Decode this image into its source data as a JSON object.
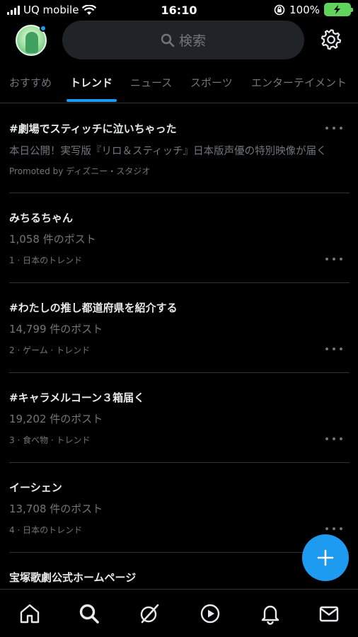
{
  "status_bar": {
    "carrier": "UQ mobile",
    "time": "16:10",
    "battery": "100%"
  },
  "header": {
    "search_placeholder": "検索"
  },
  "tabs": [
    {
      "label": "おすすめ"
    },
    {
      "label": "トレンド"
    },
    {
      "label": "ニュース"
    },
    {
      "label": "スポーツ"
    },
    {
      "label": "エンターテイメント"
    }
  ],
  "active_tab": "トレンド",
  "trends": [
    {
      "title": "#劇場でスティッチに泣いちゃった",
      "description": "本日公開！実写版『リロ＆スティッチ』日本版声優の特別映像が届く",
      "meta": "Promoted by ディズニー・スタジオ"
    },
    {
      "title": "みちるちゃん",
      "posts": "1,058 件のポスト",
      "meta": "1 · 日本のトレンド"
    },
    {
      "title": "#わたしの推し都道府県を紹介する",
      "posts": "14,799 件のポスト",
      "meta": "2 · ゲーム · トレンド"
    },
    {
      "title": "#キャラメルコーン３箱届く",
      "posts": "19,202 件のポスト",
      "meta": "3 · 食べ物 · トレンド"
    },
    {
      "title": "イーシェン",
      "posts": "13,708 件のポスト",
      "meta": "4 · 日本のトレンド"
    },
    {
      "title": "宝塚歌劇公式ホームページ"
    }
  ],
  "colors": {
    "accent": "#1d9bf0",
    "background": "#000000",
    "muted_text": "#71767b",
    "search_bg": "#202327",
    "divider": "#2f3336",
    "battery": "#5fd35b"
  },
  "icons": {
    "settings": "gear-icon",
    "search": "search-icon",
    "compose": "plus-icon",
    "nav": [
      "home-icon",
      "search-icon",
      "grok-icon",
      "play-icon",
      "bell-icon",
      "mail-icon"
    ]
  }
}
